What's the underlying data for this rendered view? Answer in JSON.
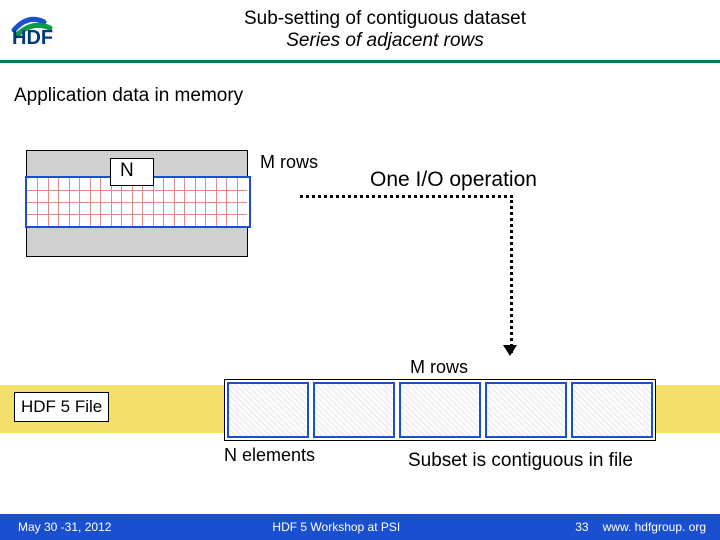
{
  "header": {
    "title": "Sub-setting of contiguous dataset",
    "subtitle": "Series of adjacent rows"
  },
  "labels": {
    "app_data": "Application data in memory",
    "n": "N",
    "m_rows_top": "M rows",
    "io": "One I/O operation",
    "m_rows_mid": "M rows",
    "hdf5_file": "HDF 5 File",
    "n_elements": "N elements",
    "subset": "Subset is contiguous in file"
  },
  "footer": {
    "date": "May 30 -31, 2012",
    "mid": "HDF 5 Workshop at PSI",
    "page": "33",
    "url": "www. hdfgroup. org"
  },
  "diagram": {
    "matrix_cols": 21,
    "matrix_sel_rows": 4,
    "file_segments": 5
  }
}
